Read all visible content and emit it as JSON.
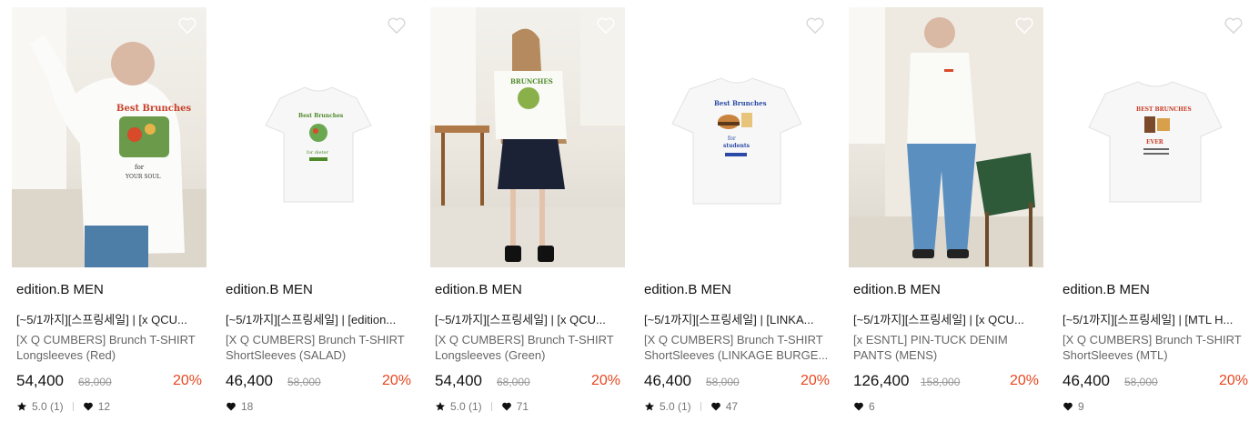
{
  "colors": {
    "discount": "#e8461f",
    "muted": "#999999"
  },
  "products": [
    {
      "brand": "edition.B MEN",
      "tagline": "[~5/1까지][스프링세일] | [x QCU...",
      "name_line1": "[X Q CUMBERS] Brunch T-SHIRT",
      "name_line2": "Longsleeves (Red)",
      "price": "54,400",
      "original_price": "68,000",
      "discount": "20%",
      "rating": "5.0 (1)",
      "likes": "12",
      "image": "model-back-longsleeve-red-photo"
    },
    {
      "brand": "edition.B MEN",
      "tagline": "[~5/1까지][스프링세일] | [edition...",
      "name_line1": "[X Q CUMBERS] Brunch T-SHIRT",
      "name_line2": "ShortSleeves (SALAD)",
      "price": "46,400",
      "original_price": "58,000",
      "discount": "20%",
      "rating": null,
      "likes": "18",
      "image": "white-tshirt-salad-print"
    },
    {
      "brand": "edition.B MEN",
      "tagline": "[~5/1까지][스프링세일] | [x QCU...",
      "name_line1": "[X Q CUMBERS] Brunch T-SHIRT",
      "name_line2": "Longsleeves (Green)",
      "price": "54,400",
      "original_price": "68,000",
      "discount": "20%",
      "rating": "5.0 (1)",
      "likes": "71",
      "image": "model-back-longsleeve-green-photo"
    },
    {
      "brand": "edition.B MEN",
      "tagline": "[~5/1까지][스프링세일] | [LINKA...",
      "name_line1": "[X Q CUMBERS] Brunch T-SHIRT",
      "name_line2": "ShortSleeves (LINKAGE BURGE...",
      "price": "46,400",
      "original_price": "58,000",
      "discount": "20%",
      "rating": "5.0 (1)",
      "likes": "47",
      "image": "white-tshirt-burger-print"
    },
    {
      "brand": "edition.B MEN",
      "tagline": "[~5/1까지][스프링세일] | [x QCU...",
      "name_line1": "[x ESNTL] PIN-TUCK DENIM",
      "name_line2": "PANTS (MENS)",
      "price": "126,400",
      "original_price": "158,000",
      "discount": "20%",
      "rating": null,
      "likes": "6",
      "image": "model-denim-pants-photo"
    },
    {
      "brand": "edition.B MEN",
      "tagline": "[~5/1까지][스프링세일] | [MTL H...",
      "name_line1": "[X Q CUMBERS] Brunch T-SHIRT",
      "name_line2": "ShortSleeves (MTL)",
      "price": "46,400",
      "original_price": "58,000",
      "discount": "20%",
      "rating": null,
      "likes": "9",
      "image": "white-tshirt-mtl-print"
    }
  ]
}
